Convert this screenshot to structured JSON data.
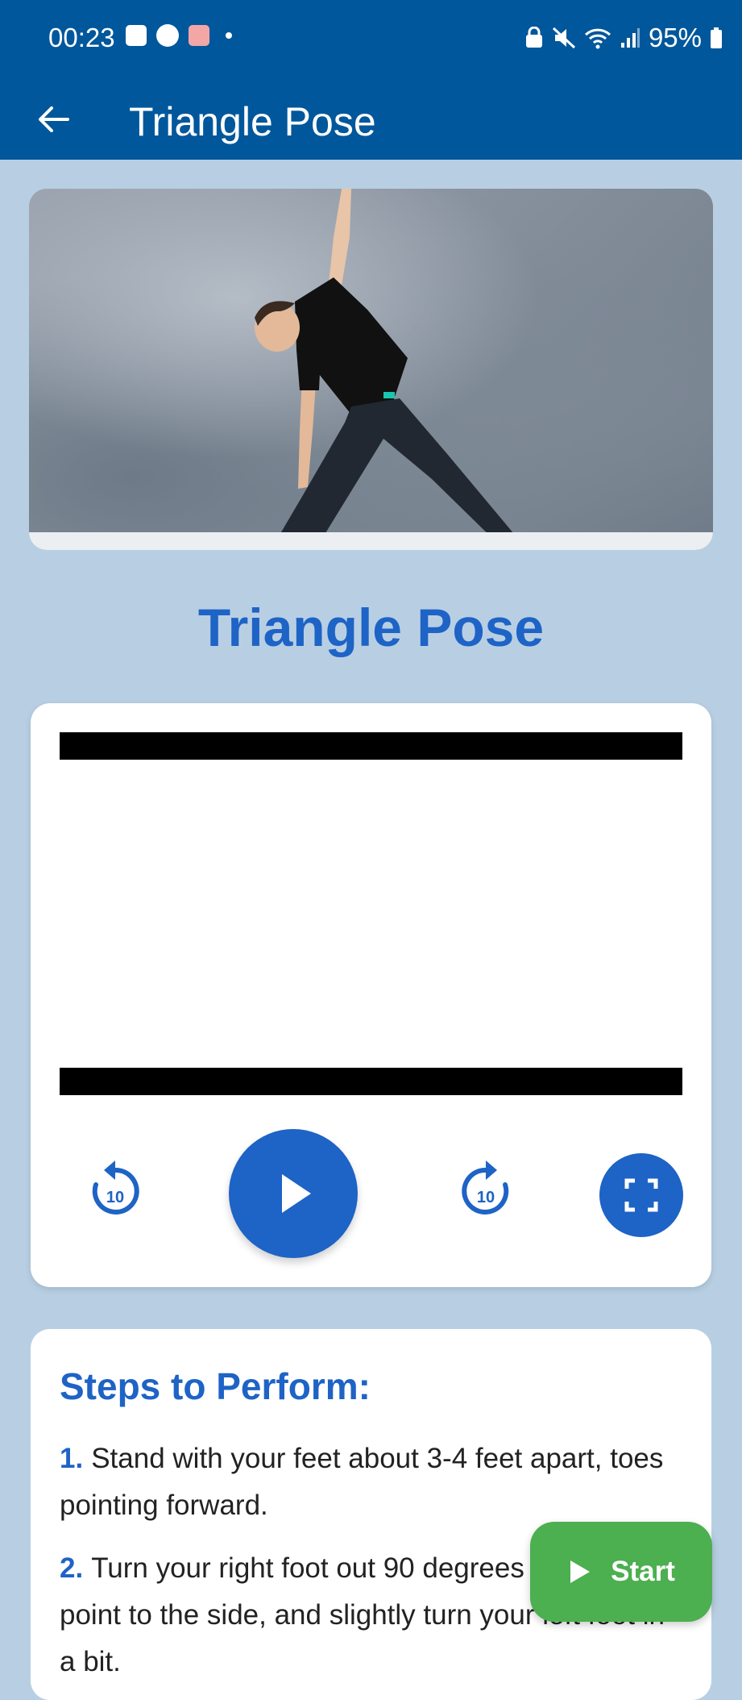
{
  "status_bar": {
    "time": "00:23",
    "battery": "95%",
    "left_icons": [
      "gallery-icon",
      "face-icon",
      "store-icon",
      "dot"
    ],
    "right_icons": [
      "lock-icon",
      "mute-icon",
      "wifi-icon",
      "signal-icon",
      "battery-icon"
    ]
  },
  "app_bar": {
    "title": "Triangle Pose",
    "back_icon": "arrow-left-icon",
    "color": "#01579b"
  },
  "hero_image": {
    "subject": "triangle-pose-photo"
  },
  "pose": {
    "title": "Triangle Pose",
    "title_color": "#1e63c6"
  },
  "player": {
    "rewind_label": "10",
    "forward_label": "10",
    "play_icon": "play-icon",
    "fullscreen_icon": "fullscreen-icon",
    "accent": "#1e63c6"
  },
  "steps": {
    "title": "Steps to Perform:",
    "items": [
      {
        "num": "1.",
        "text": "Stand with your feet about 3-4 feet apart, toes pointing forward."
      },
      {
        "num": "2.",
        "text": "Turn your right foot out 90 degrees so your toes point to the side, and slightly turn your left foot in a bit."
      }
    ]
  },
  "start_button": {
    "label": "Start",
    "color": "#4caf50"
  }
}
